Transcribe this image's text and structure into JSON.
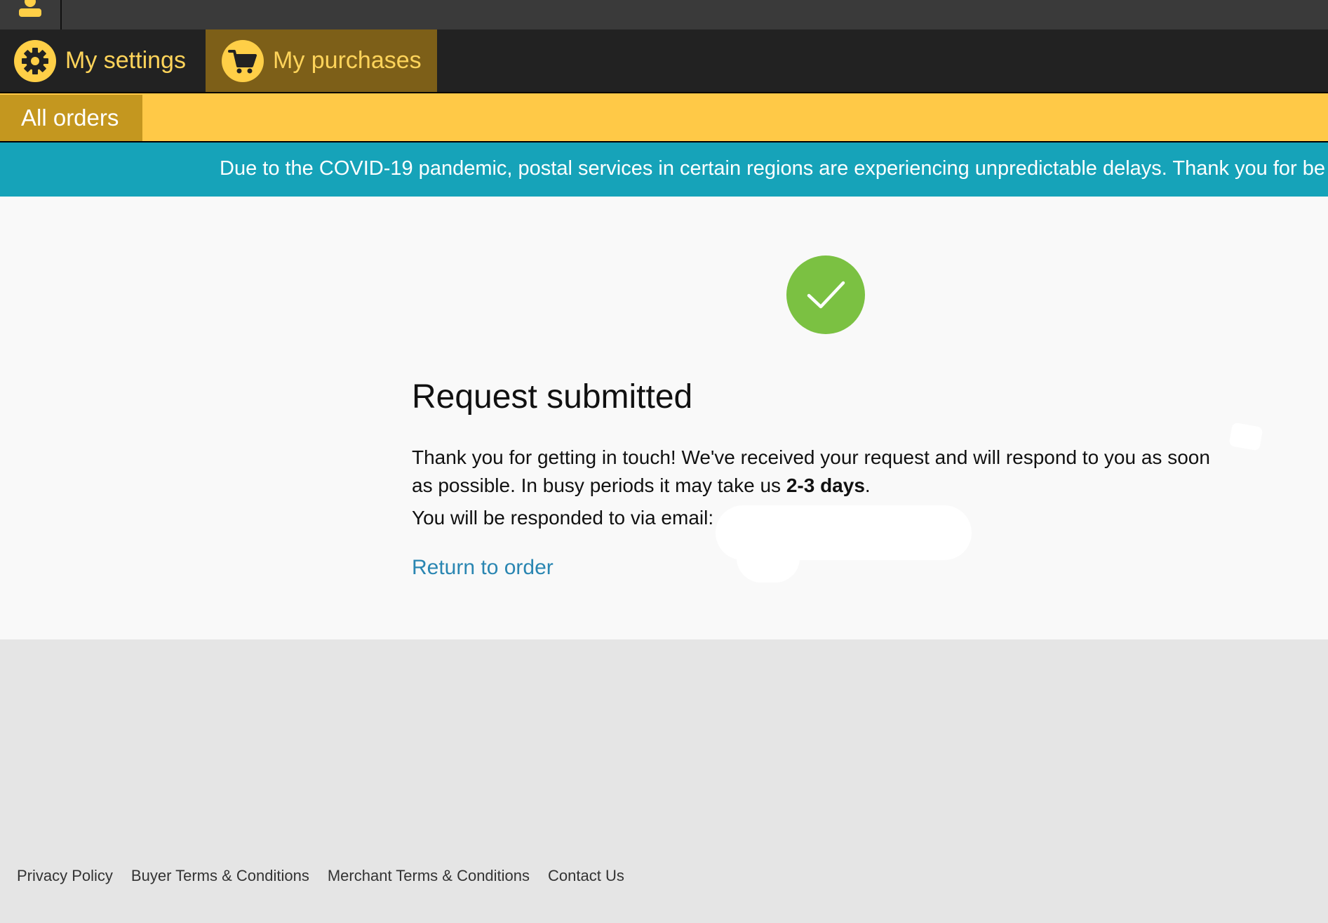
{
  "nav": {
    "settings_label": "My settings",
    "purchases_label": "My purchases",
    "subtab_label": "All orders"
  },
  "banner": {
    "text": "Due to the COVID-19 pandemic, postal services in certain regions are experiencing unpredictable delays. Thank you for be"
  },
  "confirmation": {
    "title": "Request submitted",
    "message_part1": "Thank you for getting in touch! We've received your request and will respond to you as soon as possible. In busy periods it may take us ",
    "message_bold": "2-3 days",
    "message_part2": ".",
    "email_label": "You will be responded to via email:",
    "return_link": "Return to order"
  },
  "footer": {
    "links": [
      "Privacy Policy",
      "Buyer Terms & Conditions",
      "Merchant Terms & Conditions",
      "Contact Us"
    ]
  },
  "colors": {
    "accent_yellow": "#ffc947",
    "banner_teal": "#16a3b9",
    "success_green": "#7bc142",
    "link_blue": "#2a86b2"
  },
  "icons": {
    "user": "user-icon",
    "settings": "gear-icon",
    "purchases": "cart-icon",
    "success": "checkmark-icon"
  }
}
